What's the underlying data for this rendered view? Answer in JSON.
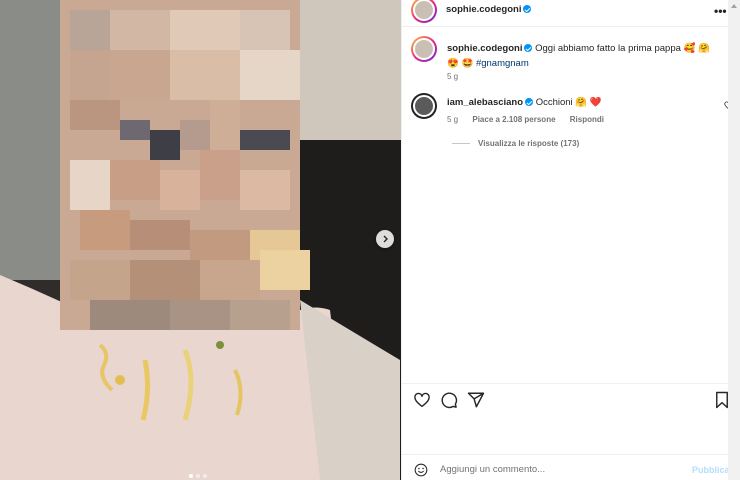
{
  "post": {
    "author": "sophie.codegoni",
    "verified": true,
    "caption": "Oggi abbiamo fatto la prima pappa 🥰 🤗",
    "caption_line2": "😍 🤩",
    "hashtag": "#gnamgnam",
    "time": "5 g",
    "carousel": {
      "count": 3,
      "active": 1
    }
  },
  "comments": [
    {
      "author": "iam_alebasciano",
      "verified": true,
      "text": "Occhioni 🤗 ❤️",
      "time": "5 g",
      "likes": "Piace a 2.108 persone",
      "reply_label": "Rispondi",
      "view_replies": "Visualizza le risposte (173)"
    }
  ],
  "composer": {
    "placeholder": "Aggiungi un commento...",
    "publish_label": "Pubblica"
  },
  "icons": {
    "more": "more-options-icon",
    "like": "heart-icon",
    "comment": "comment-icon",
    "share": "send-icon",
    "save": "bookmark-icon",
    "emoji": "emoji-icon",
    "next": "chevron-right-icon"
  },
  "colors": {
    "accent": "#0095f6",
    "hashtag": "#00376b",
    "publish_disabled": "#b2dffc",
    "secondary_text": "#737373"
  }
}
